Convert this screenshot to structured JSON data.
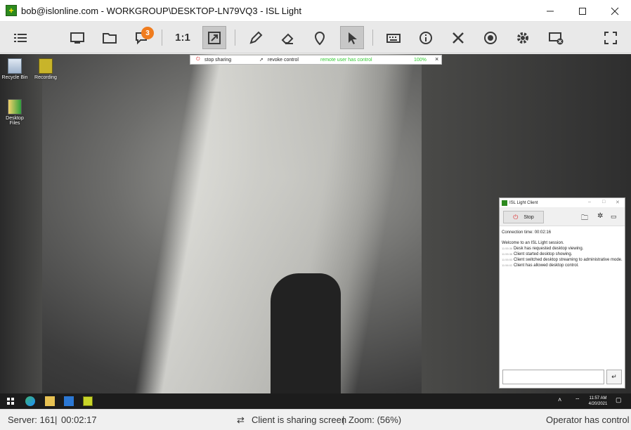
{
  "window": {
    "title": "bob@islonline.com - WORKGROUP\\DESKTOP-LN79VQ3 - ISL Light",
    "controls": [
      "minimize-icon",
      "maximize-icon",
      "close-icon"
    ]
  },
  "toolbar": {
    "chat_badge": "3",
    "ratio_label": "1:1",
    "icons": [
      "menu-icon",
      "monitor-icon",
      "folder-icon",
      "chat-icon",
      "fit-screen-icon",
      "pen-icon",
      "eraser-icon",
      "pin-icon",
      "pointer-icon",
      "keyboard-icon",
      "info-icon",
      "tools-icon",
      "record-icon",
      "settings-icon",
      "disconnect-icon",
      "fullscreen-icon"
    ]
  },
  "share_bar": {
    "stop_sharing": "stop sharing",
    "revoke_control": "revoke control",
    "status": "remote user has control",
    "percent": "100%",
    "close": "×"
  },
  "desktop": {
    "icons": [
      {
        "label": "Recycle Bin"
      },
      {
        "label": "Recording"
      },
      {
        "label": "Desktop Files"
      }
    ]
  },
  "taskbar": {
    "time": "11:57 AM",
    "date": "4/20/2021"
  },
  "client_window": {
    "title": "ISL Light Client",
    "stop_label": "Stop",
    "connection_time": "Connection time: 00:02:16",
    "welcome": "Welcome to an ISL Light session.",
    "log": [
      {
        "time": "11:55:36",
        "text": "Desk has requested desktop viewing."
      },
      {
        "time": "11:55:38",
        "text": "Client started desktop showing."
      },
      {
        "time": "11:55:53",
        "text": "Client switched desktop streaming to administrative mode."
      },
      {
        "time": "11:56:02",
        "text": "Client has allowed desktop control."
      }
    ]
  },
  "statusbar": {
    "server": "Server: 161",
    "sep1": "|",
    "elapsed": "00:02:17",
    "sharing": "Client is sharing screen",
    "sep2": "|",
    "zoom": "Zoom: (56%)",
    "control": "Operator has control"
  },
  "colors": {
    "accent_orange": "#f07c1e",
    "status_green": "#33cc33",
    "logo_green": "#2d8a1f"
  }
}
